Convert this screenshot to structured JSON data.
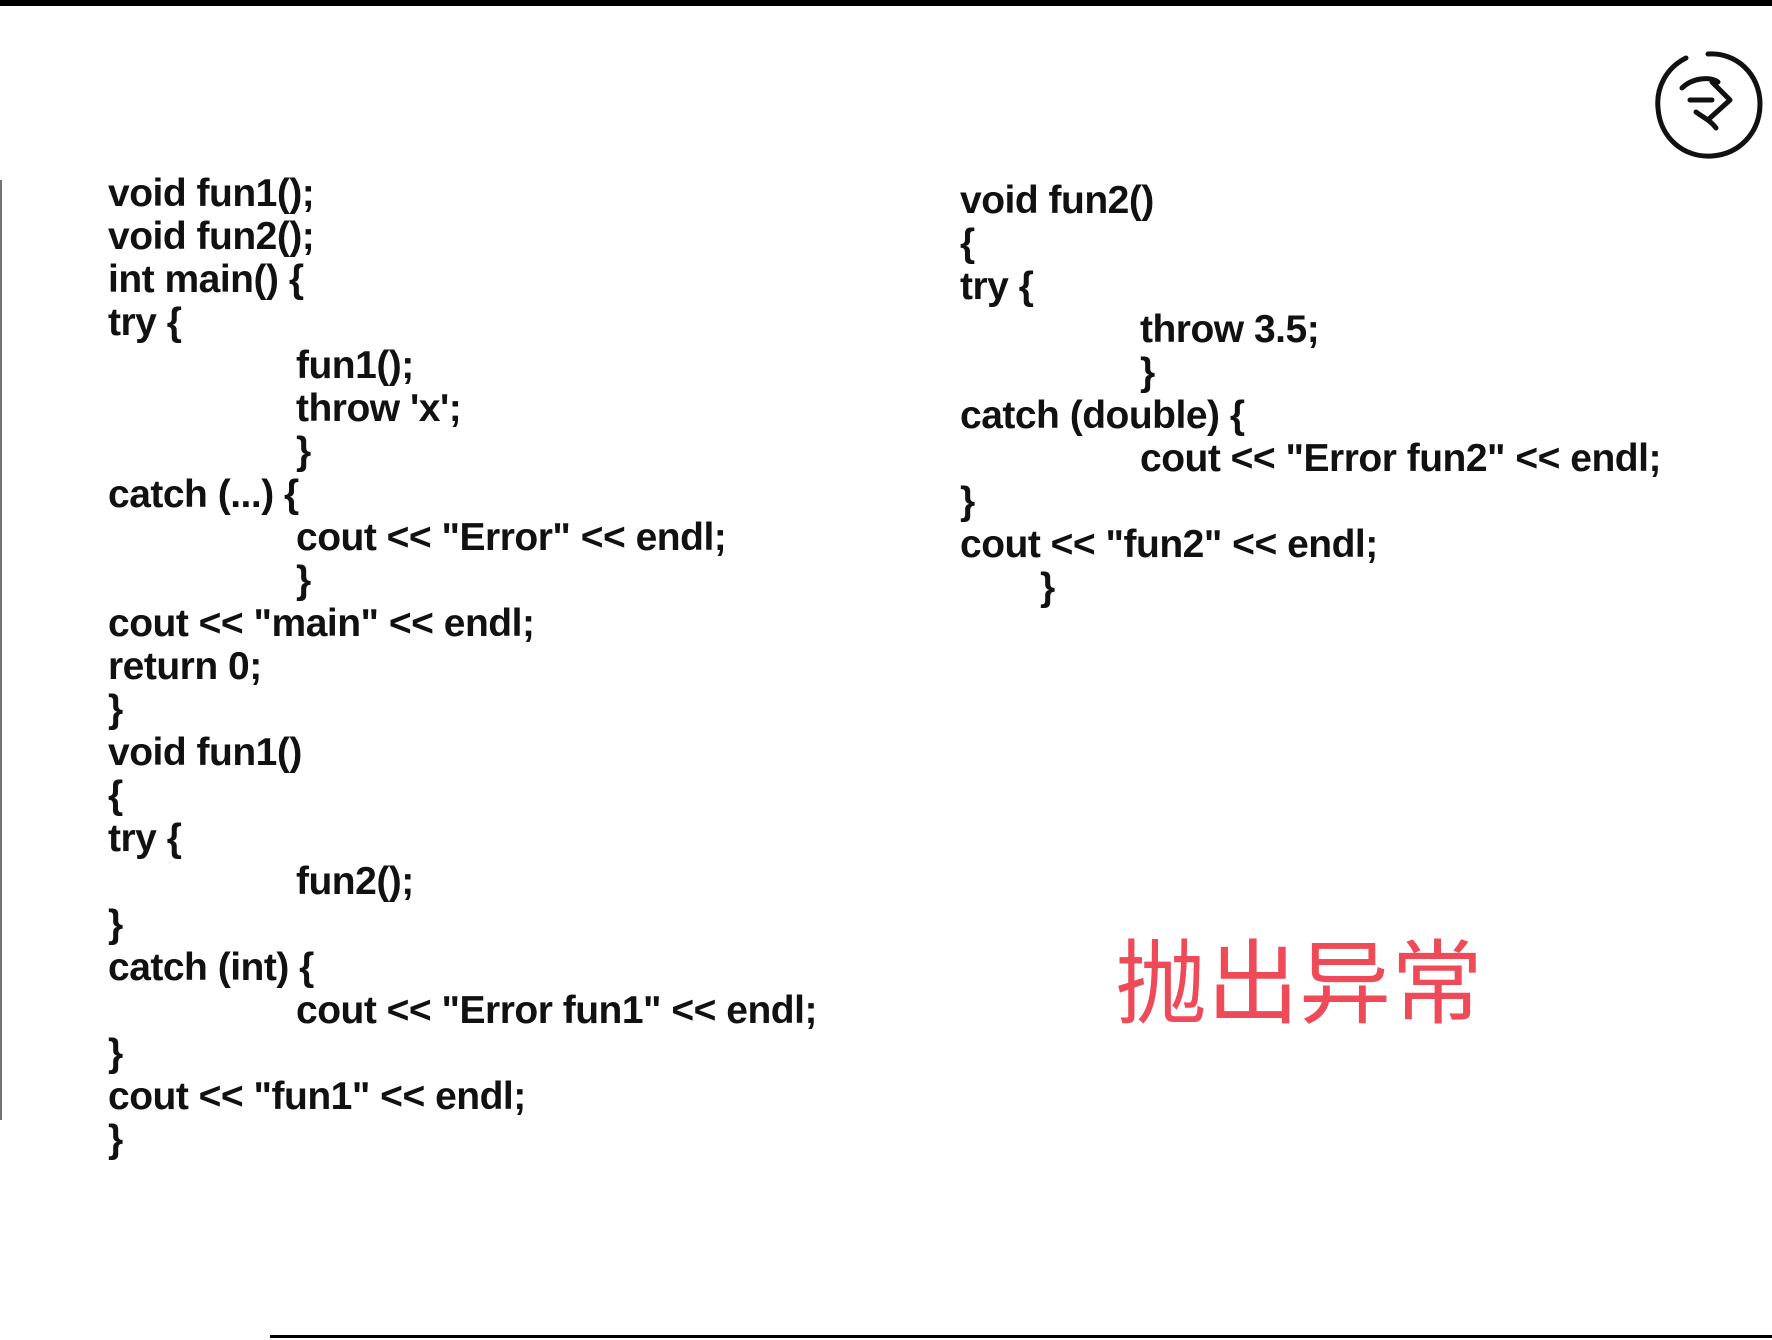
{
  "code_left": [
    {
      "text": "void fun1();",
      "indent": 0
    },
    {
      "text": "void fun2();",
      "indent": 0
    },
    {
      "text": "int main() {",
      "indent": 0
    },
    {
      "text": "try {",
      "indent": 0
    },
    {
      "text": "fun1();",
      "indent": 1
    },
    {
      "text": "throw 'x';",
      "indent": 1
    },
    {
      "text": "}",
      "indent": 1
    },
    {
      "text": "catch (...) {",
      "indent": 0
    },
    {
      "text": "cout << \"Error\" << endl;",
      "indent": 1
    },
    {
      "text": "}",
      "indent": 1
    },
    {
      "text": "cout << \"main\" << endl;",
      "indent": 0
    },
    {
      "text": "return 0;",
      "indent": 0
    },
    {
      "text": "}",
      "indent": 0
    },
    {
      "text": "void fun1()",
      "indent": 0
    },
    {
      "text": "{",
      "indent": 0
    },
    {
      "text": "try {",
      "indent": 0
    },
    {
      "text": "fun2();",
      "indent": 1
    },
    {
      "text": "}",
      "indent": 0
    },
    {
      "text": "catch (int) {",
      "indent": 0
    },
    {
      "text": "cout << \"Error fun1\" << endl;",
      "indent": 1
    },
    {
      "text": "}",
      "indent": 0
    },
    {
      "text": "cout << \"fun1\" << endl;",
      "indent": 0
    },
    {
      "text": "}",
      "indent": 0
    }
  ],
  "code_right": [
    {
      "text": "void fun2()",
      "indent": 0
    },
    {
      "text": "{",
      "indent": 0
    },
    {
      "text": "try {",
      "indent": 0
    },
    {
      "text": "throw 3.5;",
      "indent": 2
    },
    {
      "text": "}",
      "indent": 2
    },
    {
      "text": "catch (double) {",
      "indent": 0
    },
    {
      "text": "cout << \"Error fun2\" << endl;",
      "indent": 2
    },
    {
      "text": "}",
      "indent": 0
    },
    {
      "text": "cout << \"fun2\" << endl;",
      "indent": 0
    },
    {
      "text": "}",
      "indent": 3
    }
  ],
  "caption": "抛出异常",
  "colors": {
    "caption": "#ee4a57",
    "code_text": "#111111",
    "rules": "#000000"
  },
  "icons": {
    "page_badge": "circled-page-number-icon"
  }
}
